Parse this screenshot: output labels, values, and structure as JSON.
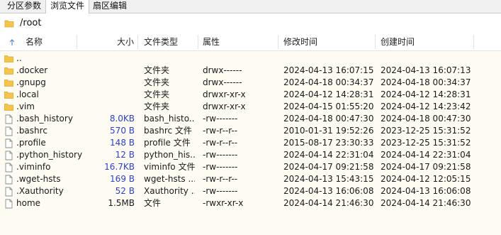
{
  "tabs": [
    {
      "label": "分区参数",
      "active": false
    },
    {
      "label": "浏览文件",
      "active": true
    },
    {
      "label": "扇区编辑",
      "active": false
    }
  ],
  "path": "/root",
  "columns": {
    "name": "名称",
    "size": "大小",
    "type": "文件类型",
    "attr": "属性",
    "mtime": "修改时间",
    "ctime": "创建时间"
  },
  "colors": {
    "folder": "#f3c54b",
    "folder_dark": "#e0a82e",
    "list_bg": "#fdfbf2",
    "size_text": "#2a3fd8"
  },
  "files": [
    {
      "icon": "folder-icon",
      "name": "..",
      "size": "",
      "type": "",
      "attr": "",
      "mtime": "",
      "ctime": ""
    },
    {
      "icon": "folder-icon",
      "name": ".docker",
      "size": "",
      "type": "文件夹",
      "attr": "drwx------",
      "mtime": "2024-04-13 16:07:15",
      "ctime": "2024-04-13 16:07:13"
    },
    {
      "icon": "folder-icon",
      "name": ".gnupg",
      "size": "",
      "type": "文件夹",
      "attr": "drwx------",
      "mtime": "2024-04-18 00:34:37",
      "ctime": "2024-04-18 00:34:37"
    },
    {
      "icon": "folder-icon",
      "name": ".local",
      "size": "",
      "type": "文件夹",
      "attr": "drwxr-xr-x",
      "mtime": "2024-04-12 14:28:31",
      "ctime": "2024-04-12 14:28:31"
    },
    {
      "icon": "folder-icon",
      "name": ".vim",
      "size": "",
      "type": "文件夹",
      "attr": "drwxr-xr-x",
      "mtime": "2024-04-15 01:55:20",
      "ctime": "2024-04-12 14:23:42"
    },
    {
      "icon": "file-icon",
      "name": ".bash_history",
      "size": "8.0KB",
      "type": "bash_histo...",
      "attr": "-rw-------",
      "mtime": "2024-04-18 00:47:30",
      "ctime": "2024-04-18 00:47:30"
    },
    {
      "icon": "file-icon",
      "name": ".bashrc",
      "size": "570 B",
      "type": "bashrc 文件",
      "attr": "-rw-r--r--",
      "mtime": "2010-01-31 19:52:26",
      "ctime": "2023-12-25 15:31:52"
    },
    {
      "icon": "file-icon",
      "name": ".profile",
      "size": "148 B",
      "type": "profile 文件",
      "attr": "-rw-r--r--",
      "mtime": "2015-08-17 23:30:33",
      "ctime": "2023-12-25 15:31:52"
    },
    {
      "icon": "file-icon",
      "name": ".python_history",
      "size": "12 B",
      "type": "python_his...",
      "attr": "-rw-------",
      "mtime": "2024-04-14 22:31:04",
      "ctime": "2024-04-14 22:31:04"
    },
    {
      "icon": "file-icon",
      "name": ".viminfo",
      "size": "16.7KB",
      "type": "viminfo 文件",
      "attr": "-rw-------",
      "mtime": "2024-04-17 09:21:58",
      "ctime": "2024-04-17 09:21:58"
    },
    {
      "icon": "file-icon",
      "name": ".wget-hsts",
      "size": "169 B",
      "type": "wget-hsts ...",
      "attr": "-rw-r--r--",
      "mtime": "2024-04-13 15:43:15",
      "ctime": "2024-04-12 12:05:15"
    },
    {
      "icon": "file-icon",
      "name": ".Xauthority",
      "size": "52 B",
      "type": "Xauthority ...",
      "attr": "-rw-------",
      "mtime": "2024-04-13 16:06:08",
      "ctime": "2024-04-13 16:06:08"
    },
    {
      "icon": "file-icon",
      "name": "home",
      "size": "1.5MB",
      "type": "文件",
      "attr": "-rwxr-xr-x",
      "mtime": "2024-04-14 21:46:30",
      "ctime": "2024-04-14 21:46:30"
    }
  ]
}
